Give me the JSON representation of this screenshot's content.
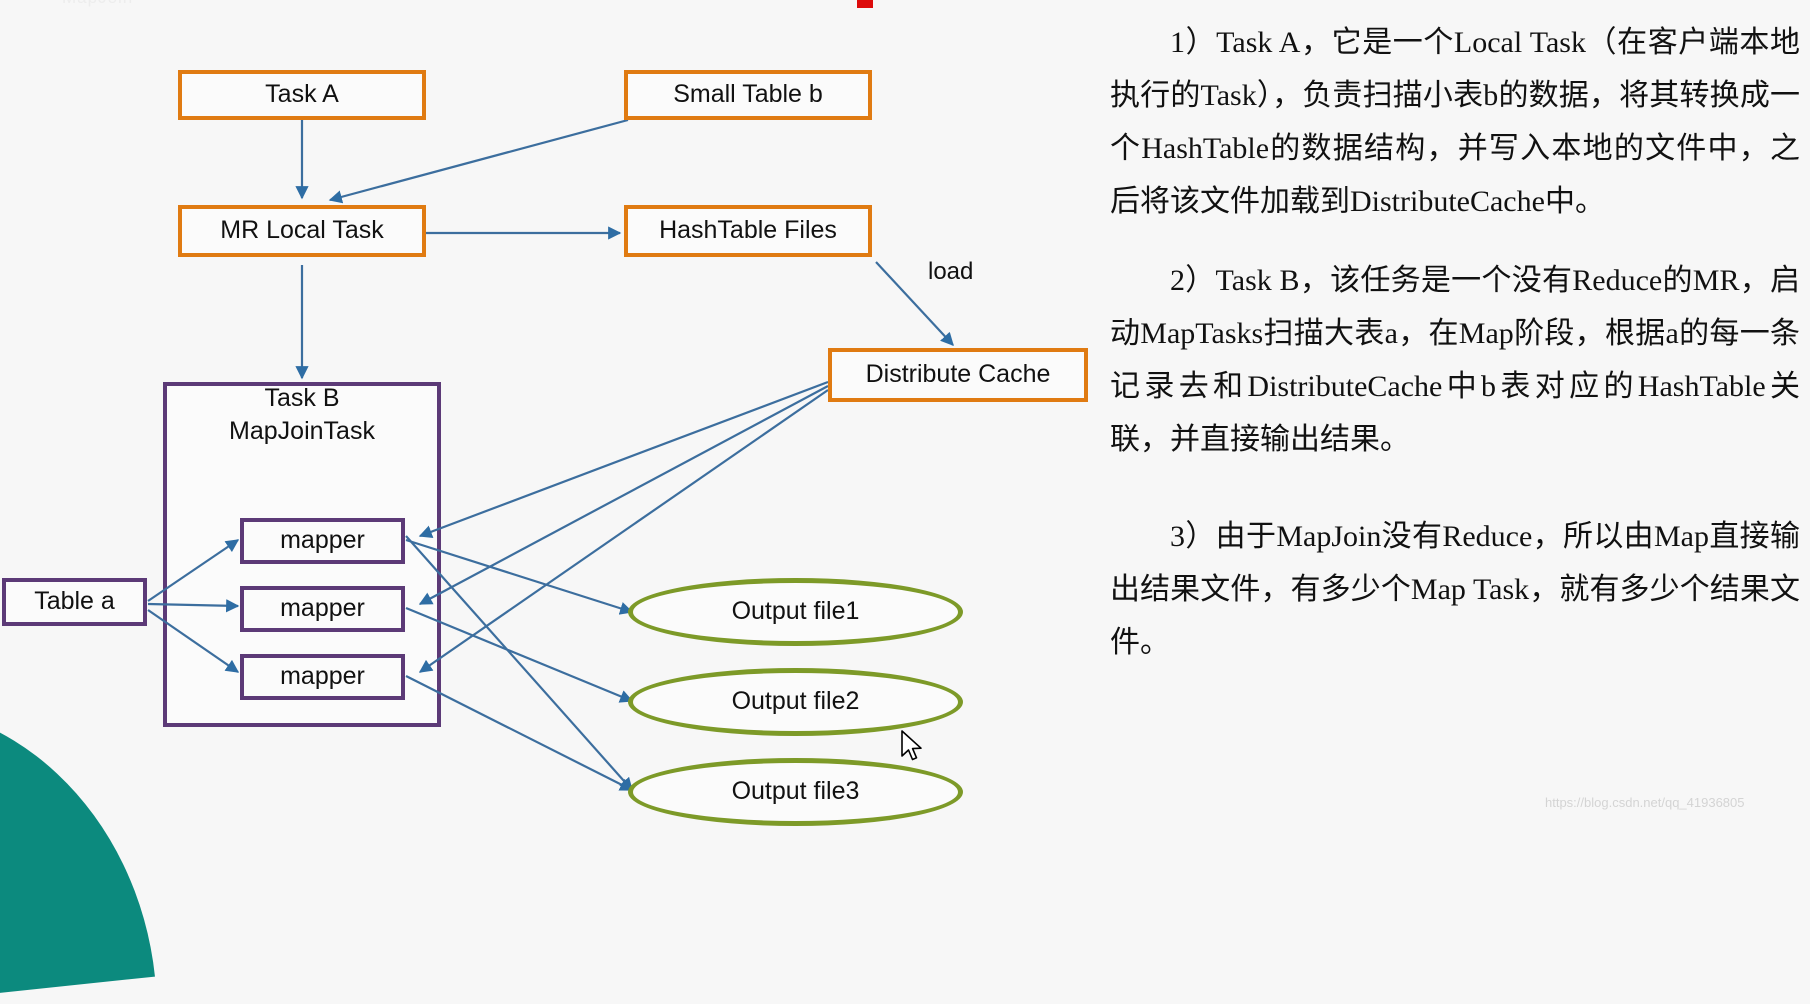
{
  "slide": {
    "background": "#f7f7f7",
    "accent_orange": "#e07b12",
    "accent_purple": "#5c3a77",
    "accent_green": "#7d9a28",
    "accent_teal": "#0c8a7e",
    "accent_blue": "#3c6e9e",
    "accent_red": "#dd0b0b",
    "watermark": "https://blog.csdn.net/qq_41936805",
    "top_ghost_text": "MapJoin"
  },
  "diagram": {
    "nodes": {
      "task_a": "Task A",
      "small_table_b": "Small Table b",
      "mr_local_task": "MR Local Task",
      "hashtable_files": "HashTable Files",
      "distribute_cache": "Distribute Cache",
      "table_a": "Table a",
      "task_b_title_line1": "Task B",
      "task_b_title_line2": "MapJoinTask",
      "mapper1": "mapper",
      "mapper2": "mapper",
      "mapper3": "mapper",
      "output_file1": "Output file1",
      "output_file2": "Output file2",
      "output_file3": "Output file3"
    },
    "edge_labels": {
      "load": "load"
    }
  },
  "notes": {
    "paragraph1": "1）Task A，它是一个Local Task（在客户端本地执行的Task），负责扫描小表b的数据，将其转换成一个HashTable的数据结构，并写入本地的文件中，之后将该文件加载到DistributeCache中。",
    "paragraph2": "2）Task B，该任务是一个没有Reduce的MR，启动MapTasks扫描大表a，在Map阶段，根据a的每一条记录去和DistributeCache中b表对应的HashTable关联，并直接输出结果。",
    "paragraph3": "3）由于MapJoin没有Reduce，所以由Map直接输出结果文件，有多少个Map Task，就有多少个结果文件。"
  }
}
